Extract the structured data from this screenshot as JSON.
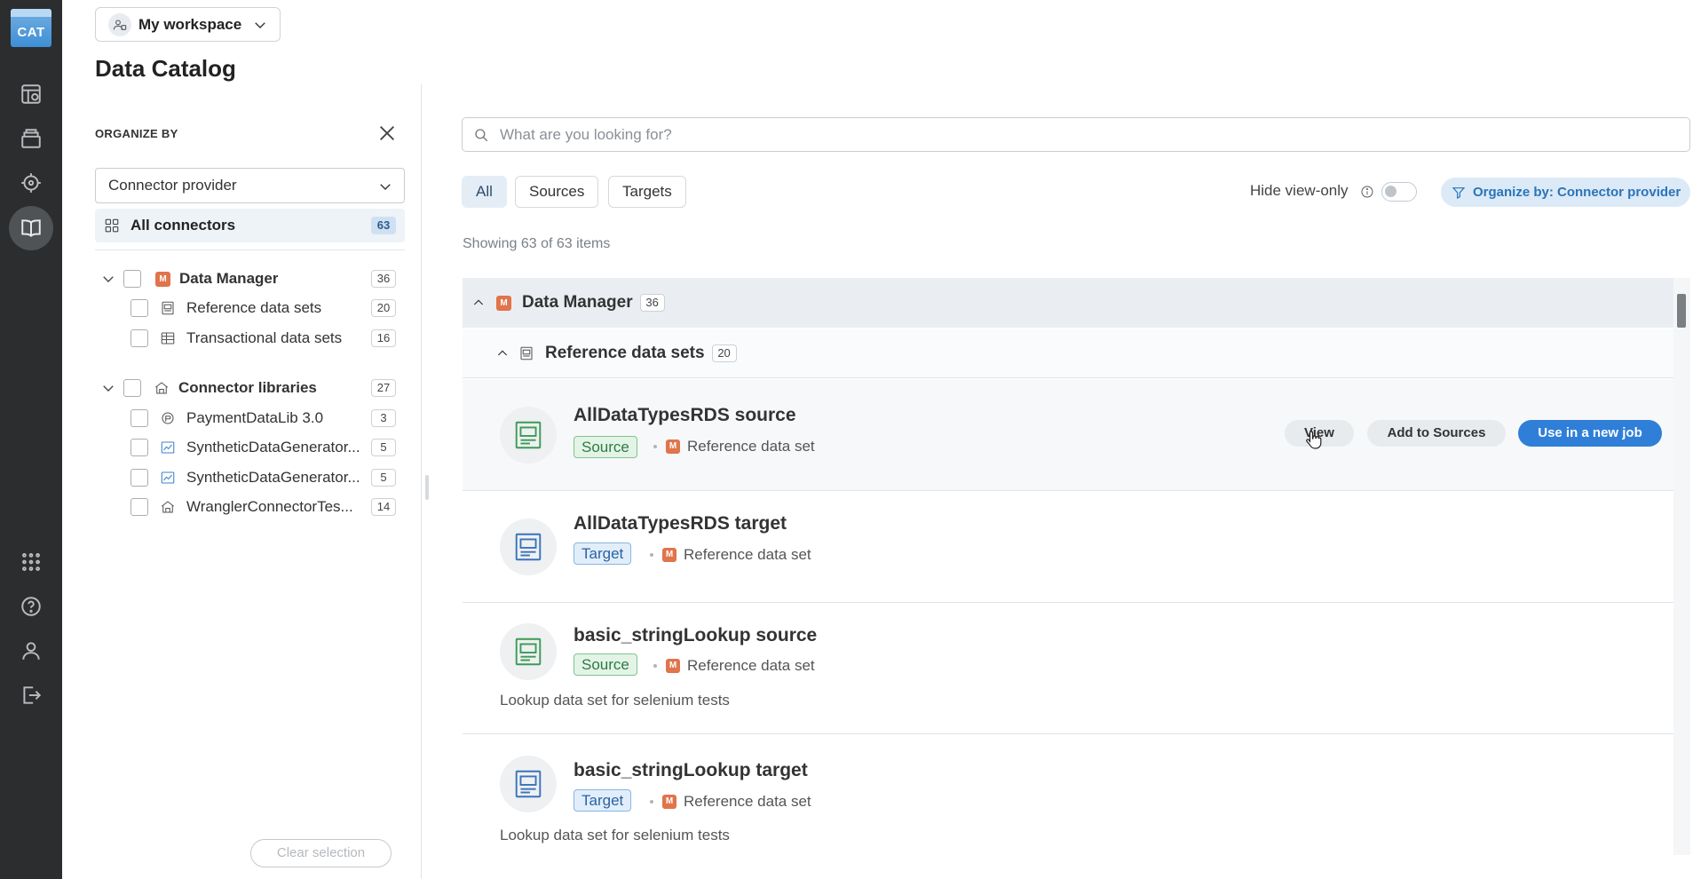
{
  "app": {
    "logo_text": "CAT",
    "workspace": "My workspace",
    "page_title": "Data Catalog"
  },
  "rail": {
    "icons": [
      "jobs-icon",
      "projects-icon",
      "monitor-icon",
      "catalog-icon",
      "apps-icon",
      "help-icon",
      "user-icon",
      "logout-icon"
    ]
  },
  "sidebar": {
    "organize_by_label": "ORGANIZE BY",
    "organize_select_value": "Connector provider",
    "all_connectors": {
      "label": "All connectors",
      "count": "63"
    },
    "tree": [
      {
        "label": "Data Manager",
        "count": "36",
        "children": [
          {
            "label": "Reference data sets",
            "count": "20"
          },
          {
            "label": "Transactional data sets",
            "count": "16"
          }
        ]
      },
      {
        "label": "Connector libraries",
        "count": "27",
        "children": [
          {
            "label": "PaymentDataLib 3.0",
            "count": "3"
          },
          {
            "label": "SyntheticDataGenerator...",
            "count": "5"
          },
          {
            "label": "SyntheticDataGenerator...",
            "count": "5"
          },
          {
            "label": "WranglerConnectorTes...",
            "count": "14"
          }
        ]
      }
    ],
    "clear_selection": "Clear selection"
  },
  "main": {
    "search_placeholder": "What are you looking for?",
    "filters": [
      "All",
      "Sources",
      "Targets"
    ],
    "hide_view_only": "Hide view-only",
    "organize_by_button": "Organize by: Connector provider",
    "showing": "Showing 63 of 63 items",
    "group": {
      "label": "Data Manager",
      "count": "36"
    },
    "subgroup": {
      "label": "Reference data sets",
      "count": "20"
    },
    "items": [
      {
        "name": "AllDataTypesRDS source",
        "tag": "Source",
        "type": "Reference data set",
        "description": ""
      },
      {
        "name": "AllDataTypesRDS target",
        "tag": "Target",
        "type": "Reference data set",
        "description": ""
      },
      {
        "name": "basic_stringLookup source",
        "tag": "Source",
        "type": "Reference data set",
        "description": "Lookup data set for selenium tests"
      },
      {
        "name": "basic_stringLookup target",
        "tag": "Target",
        "type": "Reference data set",
        "description": "Lookup data set for selenium tests"
      }
    ],
    "actions": {
      "view": "View",
      "add": "Add to Sources",
      "use": "Use in a new job"
    }
  },
  "colors": {
    "rail_bg": "#2b2d2f",
    "accent": "#2f7fd8",
    "source_green": "#3b9a55",
    "target_blue": "#3a73b9",
    "manager_orange": "#e0744b"
  },
  "badge_letter": "M"
}
